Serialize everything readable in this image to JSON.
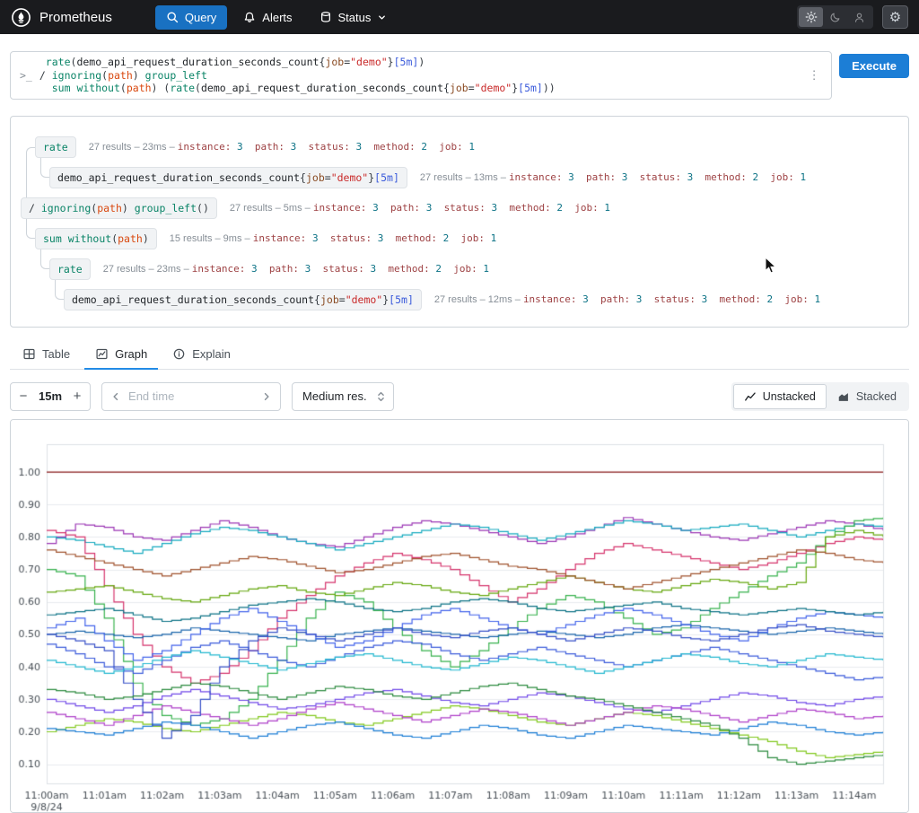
{
  "navbar": {
    "brand": "Prometheus",
    "query_label": "Query",
    "alerts_label": "Alerts",
    "status_label": "Status"
  },
  "query": {
    "prompt": ">_",
    "kebab": "⋮",
    "execute_label": "Execute",
    "code_lines": [
      [
        [
          "t",
          " "
        ],
        [
          "fn",
          "rate"
        ],
        [
          "p",
          "("
        ],
        [
          "m",
          "demo_api_request_duration_seconds_count"
        ],
        [
          "p",
          "{"
        ],
        [
          "lbl",
          "job"
        ],
        [
          "op",
          "="
        ],
        [
          "str",
          "\"demo\""
        ],
        [
          "p",
          "}"
        ],
        [
          "dur",
          "[5m]"
        ],
        [
          "p",
          ")"
        ]
      ],
      [
        [
          "op",
          "/"
        ],
        [
          "t",
          " "
        ],
        [
          "kw",
          "ignoring"
        ],
        [
          "p",
          "("
        ],
        [
          "arg",
          "path"
        ],
        [
          "p",
          ")"
        ],
        [
          "t",
          " "
        ],
        [
          "kw",
          "group_left"
        ]
      ],
      [
        [
          "t",
          "  "
        ],
        [
          "kw",
          "sum"
        ],
        [
          "t",
          " "
        ],
        [
          "kw",
          "without"
        ],
        [
          "p",
          "("
        ],
        [
          "arg",
          "path"
        ],
        [
          "p",
          ")"
        ],
        [
          "p",
          " ("
        ],
        [
          "fn",
          "rate"
        ],
        [
          "p",
          "("
        ],
        [
          "m",
          "demo_api_request_duration_seconds_count"
        ],
        [
          "p",
          "{"
        ],
        [
          "lbl",
          "job"
        ],
        [
          "op",
          "="
        ],
        [
          "str",
          "\"demo\""
        ],
        [
          "p",
          "}"
        ],
        [
          "dur",
          "[5m]"
        ],
        [
          "p",
          "))"
        ]
      ]
    ]
  },
  "tree": {
    "separator": "–",
    "nodes": [
      {
        "depth": 1,
        "parent": 2,
        "tokens": [
          [
            "fn",
            "rate"
          ]
        ],
        "results": "27 results",
        "duration": "23ms",
        "labels": [
          [
            "instance",
            "3"
          ],
          [
            "path",
            "3"
          ],
          [
            "status",
            "3"
          ],
          [
            "method",
            "2"
          ],
          [
            "job",
            "1"
          ]
        ]
      },
      {
        "depth": 2,
        "parent": 0,
        "tokens": [
          [
            "m",
            "demo_api_request_duration_seconds_count"
          ],
          [
            "p",
            "{"
          ],
          [
            "lbl",
            "job"
          ],
          [
            "op",
            "="
          ],
          [
            "str",
            "\"demo\""
          ],
          [
            "p",
            "}"
          ],
          [
            "dur",
            "[5m]"
          ]
        ],
        "results": "27 results",
        "duration": "13ms",
        "labels": [
          [
            "instance",
            "3"
          ],
          [
            "path",
            "3"
          ],
          [
            "status",
            "3"
          ],
          [
            "method",
            "2"
          ],
          [
            "job",
            "1"
          ]
        ]
      },
      {
        "depth": 0,
        "parent": null,
        "tokens": [
          [
            "op",
            "/"
          ],
          [
            "t",
            " "
          ],
          [
            "kw",
            "ignoring"
          ],
          [
            "p",
            "("
          ],
          [
            "arg",
            "path"
          ],
          [
            "p",
            ")"
          ],
          [
            "t",
            " "
          ],
          [
            "kw",
            "group_left"
          ],
          [
            "p",
            "()"
          ]
        ],
        "results": "27 results",
        "duration": "5ms",
        "labels": [
          [
            "instance",
            "3"
          ],
          [
            "path",
            "3"
          ],
          [
            "status",
            "3"
          ],
          [
            "method",
            "2"
          ],
          [
            "job",
            "1"
          ]
        ]
      },
      {
        "depth": 1,
        "parent": 2,
        "tokens": [
          [
            "kw",
            "sum"
          ],
          [
            "t",
            " "
          ],
          [
            "kw",
            "without"
          ],
          [
            "p",
            "("
          ],
          [
            "arg",
            "path"
          ],
          [
            "p",
            ")"
          ]
        ],
        "results": "15 results",
        "duration": "9ms",
        "labels": [
          [
            "instance",
            "3"
          ],
          [
            "status",
            "3"
          ],
          [
            "method",
            "2"
          ],
          [
            "job",
            "1"
          ]
        ]
      },
      {
        "depth": 2,
        "parent": 3,
        "tokens": [
          [
            "fn",
            "rate"
          ]
        ],
        "results": "27 results",
        "duration": "23ms",
        "labels": [
          [
            "instance",
            "3"
          ],
          [
            "path",
            "3"
          ],
          [
            "status",
            "3"
          ],
          [
            "method",
            "2"
          ],
          [
            "job",
            "1"
          ]
        ]
      },
      {
        "depth": 3,
        "parent": 4,
        "tokens": [
          [
            "m",
            "demo_api_request_duration_seconds_count"
          ],
          [
            "p",
            "{"
          ],
          [
            "lbl",
            "job"
          ],
          [
            "op",
            "="
          ],
          [
            "str",
            "\"demo\""
          ],
          [
            "p",
            "}"
          ],
          [
            "dur",
            "[5m]"
          ]
        ],
        "results": "27 results",
        "duration": "12ms",
        "labels": [
          [
            "instance",
            "3"
          ],
          [
            "path",
            "3"
          ],
          [
            "status",
            "3"
          ],
          [
            "method",
            "2"
          ],
          [
            "job",
            "1"
          ]
        ]
      }
    ]
  },
  "tabs": [
    {
      "label": "Table"
    },
    {
      "label": "Graph"
    },
    {
      "label": "Explain"
    }
  ],
  "controls": {
    "minus": "−",
    "range_value": "15m",
    "plus": "+",
    "end_time_placeholder": "End time",
    "resolution": "Medium res.",
    "unstacked_label": "Unstacked",
    "stacked_label": "Stacked"
  },
  "chart_data": {
    "type": "line",
    "title": "",
    "xlabel": "",
    "ylabel": "",
    "legend": "none",
    "grid": "horizontal",
    "x_range_minutes": [
      0,
      14.5
    ],
    "x_tick_labels": [
      "11:00am",
      "11:01am",
      "11:02am",
      "11:03am",
      "11:04am",
      "11:05am",
      "11:06am",
      "11:07am",
      "11:08am",
      "11:09am",
      "11:10am",
      "11:11am",
      "11:12am",
      "11:13am",
      "11:14am"
    ],
    "x_date_label": "9/8/24",
    "y_ticks": [
      0.1,
      0.2,
      0.3,
      0.4,
      0.5,
      0.6,
      0.7,
      0.8,
      0.9,
      1.0
    ],
    "ylim": [
      0.041,
      1.086
    ],
    "series": [
      {
        "color": "#8b1a1a",
        "values": [
          1.0,
          1.0,
          1.0,
          1.0,
          1.0,
          1.0,
          1.0,
          1.0,
          1.0,
          1.0,
          1.0,
          1.0,
          1.0,
          1.0,
          1.0,
          1.0,
          1.0,
          1.0,
          1.0,
          1.0,
          1.0,
          1.0,
          1.0,
          1.0,
          1.0,
          1.0,
          1.0,
          1.0,
          1.0,
          1.0
        ]
      },
      {
        "color": "#9c36b5",
        "values": [
          0.78,
          0.84,
          0.83,
          0.8,
          0.79,
          0.82,
          0.85,
          0.83,
          0.8,
          0.78,
          0.77,
          0.8,
          0.83,
          0.85,
          0.84,
          0.82,
          0.8,
          0.78,
          0.8,
          0.83,
          0.86,
          0.84,
          0.82,
          0.8,
          0.79,
          0.81,
          0.83,
          0.85,
          0.84,
          0.82
        ]
      },
      {
        "color": "#15aabf",
        "values": [
          0.8,
          0.79,
          0.77,
          0.75,
          0.78,
          0.81,
          0.83,
          0.82,
          0.8,
          0.78,
          0.76,
          0.78,
          0.8,
          0.82,
          0.84,
          0.83,
          0.81,
          0.79,
          0.81,
          0.83,
          0.85,
          0.84,
          0.82,
          0.83,
          0.84,
          0.82,
          0.8,
          0.82,
          0.84,
          0.83
        ]
      },
      {
        "color": "#d6336c",
        "values": [
          0.82,
          0.8,
          0.65,
          0.5,
          0.4,
          0.35,
          0.38,
          0.45,
          0.55,
          0.62,
          0.68,
          0.72,
          0.75,
          0.73,
          0.7,
          0.65,
          0.6,
          0.64,
          0.7,
          0.75,
          0.78,
          0.76,
          0.74,
          0.72,
          0.7,
          0.72,
          0.75,
          0.78,
          0.8,
          0.79
        ]
      },
      {
        "color": "#37b24d",
        "values": [
          0.7,
          0.68,
          0.55,
          0.35,
          0.25,
          0.22,
          0.24,
          0.3,
          0.42,
          0.55,
          0.63,
          0.6,
          0.52,
          0.45,
          0.4,
          0.45,
          0.52,
          0.58,
          0.62,
          0.6,
          0.55,
          0.5,
          0.52,
          0.58,
          0.63,
          0.68,
          0.72,
          0.8,
          0.85,
          0.86
        ]
      },
      {
        "color": "#66a80f",
        "values": [
          0.63,
          0.64,
          0.65,
          0.63,
          0.61,
          0.6,
          0.62,
          0.64,
          0.65,
          0.63,
          0.62,
          0.64,
          0.66,
          0.65,
          0.63,
          0.62,
          0.64,
          0.66,
          0.68,
          0.66,
          0.64,
          0.63,
          0.65,
          0.67,
          0.66,
          0.64,
          0.66,
          0.8,
          0.82,
          0.8
        ]
      },
      {
        "color": "#82c91e",
        "values": [
          0.2,
          0.22,
          0.24,
          0.23,
          0.21,
          0.2,
          0.22,
          0.24,
          0.26,
          0.25,
          0.23,
          0.22,
          0.24,
          0.26,
          0.28,
          0.27,
          0.25,
          0.23,
          0.22,
          0.24,
          0.26,
          0.25,
          0.23,
          0.21,
          0.19,
          0.17,
          0.14,
          0.12,
          0.13,
          0.14
        ]
      },
      {
        "color": "#1864ab",
        "values": [
          0.5,
          0.51,
          0.5,
          0.49,
          0.5,
          0.52,
          0.51,
          0.5,
          0.49,
          0.48,
          0.5,
          0.51,
          0.52,
          0.51,
          0.5,
          0.49,
          0.5,
          0.51,
          0.5,
          0.49,
          0.5,
          0.52,
          0.53,
          0.52,
          0.51,
          0.5,
          0.51,
          0.52,
          0.51,
          0.5
        ]
      },
      {
        "color": "#4263eb",
        "values": [
          0.52,
          0.55,
          0.48,
          0.42,
          0.45,
          0.5,
          0.55,
          0.58,
          0.54,
          0.5,
          0.46,
          0.48,
          0.52,
          0.56,
          0.58,
          0.55,
          0.52,
          0.5,
          0.53,
          0.56,
          0.58,
          0.56,
          0.53,
          0.5,
          0.48,
          0.52,
          0.55,
          0.57,
          0.56,
          0.55
        ]
      },
      {
        "color": "#3b5bdb",
        "values": [
          0.47,
          0.44,
          0.4,
          0.38,
          0.42,
          0.46,
          0.48,
          0.45,
          0.42,
          0.4,
          0.43,
          0.46,
          0.48,
          0.47,
          0.44,
          0.42,
          0.44,
          0.46,
          0.44,
          0.42,
          0.4,
          0.42,
          0.44,
          0.46,
          0.44,
          0.42,
          0.4,
          0.38,
          0.36,
          0.37
        ]
      },
      {
        "color": "#0b7285",
        "values": [
          0.56,
          0.57,
          0.58,
          0.56,
          0.54,
          0.55,
          0.57,
          0.59,
          0.6,
          0.61,
          0.6,
          0.58,
          0.57,
          0.58,
          0.6,
          0.61,
          0.6,
          0.58,
          0.57,
          0.58,
          0.59,
          0.6,
          0.58,
          0.57,
          0.56,
          0.57,
          0.58,
          0.57,
          0.56,
          0.57
        ]
      },
      {
        "color": "#7048e8",
        "values": [
          0.3,
          0.28,
          0.26,
          0.28,
          0.31,
          0.33,
          0.31,
          0.29,
          0.27,
          0.28,
          0.3,
          0.32,
          0.33,
          0.31,
          0.29,
          0.28,
          0.3,
          0.32,
          0.31,
          0.29,
          0.27,
          0.26,
          0.28,
          0.3,
          0.32,
          0.31,
          0.29,
          0.28,
          0.3,
          0.31
        ]
      },
      {
        "color": "#ae3ec9",
        "values": [
          0.26,
          0.24,
          0.22,
          0.25,
          0.28,
          0.26,
          0.24,
          0.22,
          0.24,
          0.27,
          0.29,
          0.27,
          0.25,
          0.23,
          0.25,
          0.27,
          0.26,
          0.24,
          0.22,
          0.24,
          0.26,
          0.28,
          0.27,
          0.25,
          0.23,
          0.25,
          0.27,
          0.26,
          0.24,
          0.25
        ]
      },
      {
        "color": "#1c7ed6",
        "values": [
          0.21,
          0.2,
          0.19,
          0.21,
          0.23,
          0.22,
          0.2,
          0.18,
          0.2,
          0.22,
          0.23,
          0.21,
          0.19,
          0.18,
          0.2,
          0.22,
          0.21,
          0.19,
          0.18,
          0.2,
          0.22,
          0.21,
          0.2,
          0.19,
          0.21,
          0.23,
          0.22,
          0.2,
          0.19,
          0.2
        ]
      },
      {
        "color": "#a0522d",
        "values": [
          0.76,
          0.74,
          0.72,
          0.7,
          0.68,
          0.7,
          0.72,
          0.74,
          0.73,
          0.71,
          0.69,
          0.7,
          0.72,
          0.74,
          0.75,
          0.73,
          0.71,
          0.7,
          0.68,
          0.66,
          0.64,
          0.66,
          0.68,
          0.7,
          0.72,
          0.74,
          0.76,
          0.75,
          0.73,
          0.72
        ]
      },
      {
        "color": "#364fc7",
        "values": [
          0.5,
          0.48,
          0.45,
          0.3,
          0.18,
          0.25,
          0.4,
          0.48,
          0.52,
          0.5,
          0.48,
          0.5,
          0.52,
          0.5,
          0.49,
          0.51,
          0.52,
          0.5,
          0.48,
          0.5,
          0.52,
          0.51,
          0.49,
          0.48,
          0.5,
          0.52,
          0.53,
          0.51,
          0.5,
          0.49
        ]
      },
      {
        "color": "#22b8cf",
        "values": [
          0.42,
          0.4,
          0.38,
          0.4,
          0.43,
          0.45,
          0.43,
          0.41,
          0.39,
          0.41,
          0.43,
          0.44,
          0.42,
          0.4,
          0.39,
          0.41,
          0.43,
          0.42,
          0.4,
          0.38,
          0.4,
          0.42,
          0.44,
          0.43,
          0.41,
          0.4,
          0.42,
          0.44,
          0.43,
          0.42
        ]
      },
      {
        "color": "#2b8a3e",
        "values": [
          0.33,
          0.32,
          0.3,
          0.31,
          0.33,
          0.35,
          0.34,
          0.32,
          0.3,
          0.32,
          0.34,
          0.33,
          0.31,
          0.3,
          0.32,
          0.34,
          0.35,
          0.33,
          0.31,
          0.3,
          0.28,
          0.26,
          0.24,
          0.22,
          0.18,
          0.12,
          0.1,
          0.11,
          0.12,
          0.13
        ]
      }
    ]
  }
}
